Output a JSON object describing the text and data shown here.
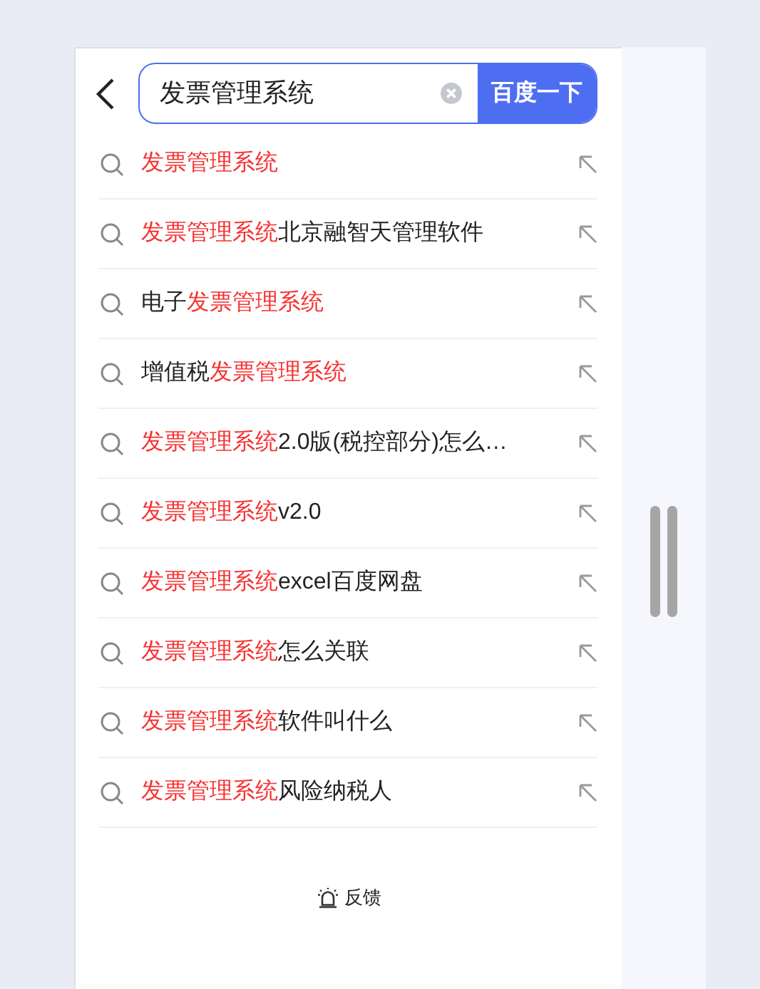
{
  "search": {
    "value": "发票管理系统",
    "button": "百度一下"
  },
  "suggestions": [
    {
      "parts": [
        {
          "text": "发票管理系统",
          "highlighted": true
        }
      ]
    },
    {
      "parts": [
        {
          "text": "发票管理系统",
          "highlighted": true
        },
        {
          "text": "北京融智天管理软件",
          "highlighted": false
        }
      ]
    },
    {
      "parts": [
        {
          "text": "电子",
          "highlighted": false
        },
        {
          "text": "发票管理系统",
          "highlighted": true
        }
      ]
    },
    {
      "parts": [
        {
          "text": "增值税",
          "highlighted": false
        },
        {
          "text": "发票管理系统",
          "highlighted": true
        }
      ]
    },
    {
      "parts": [
        {
          "text": "发票管理系统",
          "highlighted": true
        },
        {
          "text": "2.0版(税控部分)怎么…",
          "highlighted": false
        }
      ]
    },
    {
      "parts": [
        {
          "text": "发票管理系统",
          "highlighted": true
        },
        {
          "text": "v2.0",
          "highlighted": false
        }
      ]
    },
    {
      "parts": [
        {
          "text": "发票管理系统",
          "highlighted": true
        },
        {
          "text": "excel百度网盘",
          "highlighted": false
        }
      ]
    },
    {
      "parts": [
        {
          "text": "发票管理系统",
          "highlighted": true
        },
        {
          "text": "怎么关联",
          "highlighted": false
        }
      ]
    },
    {
      "parts": [
        {
          "text": "发票管理系统",
          "highlighted": true
        },
        {
          "text": "软件叫什么",
          "highlighted": false
        }
      ]
    },
    {
      "parts": [
        {
          "text": "发票管理系统",
          "highlighted": true
        },
        {
          "text": "风险纳税人",
          "highlighted": false
        }
      ]
    }
  ],
  "feedback": "反馈"
}
